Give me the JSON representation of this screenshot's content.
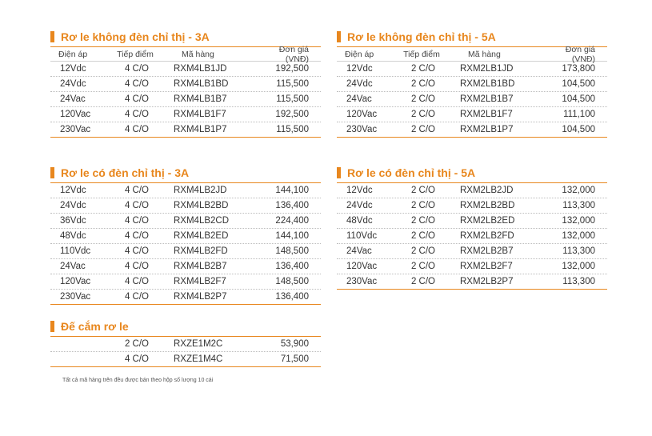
{
  "columns": {
    "voltage": "Điện áp",
    "contacts": "Tiếp điểm",
    "code": "Mã hàng",
    "price": "Đơn giá (VNĐ)"
  },
  "sections": [
    {
      "title": "Rơ le không đèn chỉ thị - 3A",
      "rows": [
        [
          "12Vdc",
          "4 C/O",
          "RXM4LB1JD",
          "192,500"
        ],
        [
          "24Vdc",
          "4 C/O",
          "RXM4LB1BD",
          "115,500"
        ],
        [
          "24Vac",
          "4 C/O",
          "RXM4LB1B7",
          "115,500"
        ],
        [
          "120Vac",
          "4 C/O",
          "RXM4LB1F7",
          "192,500"
        ],
        [
          "230Vac",
          "4 C/O",
          "RXM4LB1P7",
          "115,500"
        ]
      ]
    },
    {
      "title": "Rơ le không đèn chỉ thị - 5A",
      "rows": [
        [
          "12Vdc",
          "2 C/O",
          "RXM2LB1JD",
          "173,800"
        ],
        [
          "24Vdc",
          "2 C/O",
          "RXM2LB1BD",
          "104,500"
        ],
        [
          "24Vac",
          "2 C/O",
          "RXM2LB1B7",
          "104,500"
        ],
        [
          "120Vac",
          "2 C/O",
          "RXM2LB1F7",
          "111,100"
        ],
        [
          "230Vac",
          "2 C/O",
          "RXM2LB1P7",
          "104,500"
        ]
      ]
    },
    {
      "title": "Rơ le có đèn chỉ thị - 3A",
      "rows": [
        [
          "12Vdc",
          "4 C/O",
          "RXM4LB2JD",
          "144,100"
        ],
        [
          "24Vdc",
          "4 C/O",
          "RXM4LB2BD",
          "136,400"
        ],
        [
          "36Vdc",
          "4 C/O",
          "RXM4LB2CD",
          "224,400"
        ],
        [
          "48Vdc",
          "4 C/O",
          "RXM4LB2ED",
          "144,100"
        ],
        [
          "110Vdc",
          "4 C/O",
          "RXM4LB2FD",
          "148,500"
        ],
        [
          "24Vac",
          "4 C/O",
          "RXM4LB2B7",
          "136,400"
        ],
        [
          "120Vac",
          "4 C/O",
          "RXM4LB2F7",
          "148,500"
        ],
        [
          "230Vac",
          "4 C/O",
          "RXM4LB2P7",
          "136,400"
        ]
      ]
    },
    {
      "title": "Rơ le có đèn chỉ thị - 5A",
      "rows": [
        [
          "12Vdc",
          "2 C/O",
          "RXM2LB2JD",
          "132,000"
        ],
        [
          "24Vdc",
          "2 C/O",
          "RXM2LB2BD",
          "113,300"
        ],
        [
          "48Vdc",
          "2 C/O",
          "RXM2LB2ED",
          "132,000"
        ],
        [
          "110Vdc",
          "2 C/O",
          "RXM2LB2FD",
          "132,000"
        ],
        [
          "24Vac",
          "2 C/O",
          "RXM2LB2B7",
          "113,300"
        ],
        [
          "120Vac",
          "2 C/O",
          "RXM2LB2F7",
          "132,000"
        ],
        [
          "230Vac",
          "2 C/O",
          "RXM2LB2P7",
          "113,300"
        ]
      ]
    },
    {
      "title": "Đế cắm rơ le",
      "rows": [
        [
          "",
          "2 C/O",
          "RXZE1M2C",
          "53,900"
        ],
        [
          "",
          "4 C/O",
          "RXZE1M4C",
          "71,500"
        ]
      ]
    }
  ],
  "footnote": "Tất cả mã hàng trên đều được bán theo hộp số lượng 10 cái",
  "colors": {
    "accent": "#e8871e",
    "text": "#333333"
  }
}
